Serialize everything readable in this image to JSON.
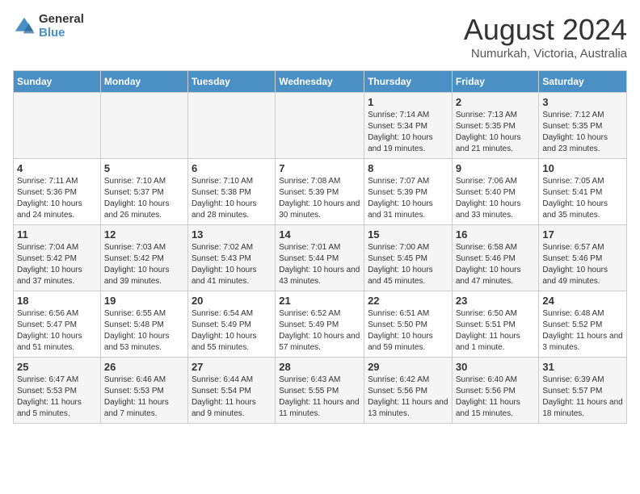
{
  "header": {
    "logo_general": "General",
    "logo_blue": "Blue",
    "month_title": "August 2024",
    "location": "Numurkah, Victoria, Australia"
  },
  "days_of_week": [
    "Sunday",
    "Monday",
    "Tuesday",
    "Wednesday",
    "Thursday",
    "Friday",
    "Saturday"
  ],
  "weeks": [
    [
      {
        "day": "",
        "info": ""
      },
      {
        "day": "",
        "info": ""
      },
      {
        "day": "",
        "info": ""
      },
      {
        "day": "",
        "info": ""
      },
      {
        "day": "1",
        "info": "Sunrise: 7:14 AM\nSunset: 5:34 PM\nDaylight: 10 hours\nand 19 minutes."
      },
      {
        "day": "2",
        "info": "Sunrise: 7:13 AM\nSunset: 5:35 PM\nDaylight: 10 hours\nand 21 minutes."
      },
      {
        "day": "3",
        "info": "Sunrise: 7:12 AM\nSunset: 5:35 PM\nDaylight: 10 hours\nand 23 minutes."
      }
    ],
    [
      {
        "day": "4",
        "info": "Sunrise: 7:11 AM\nSunset: 5:36 PM\nDaylight: 10 hours\nand 24 minutes."
      },
      {
        "day": "5",
        "info": "Sunrise: 7:10 AM\nSunset: 5:37 PM\nDaylight: 10 hours\nand 26 minutes."
      },
      {
        "day": "6",
        "info": "Sunrise: 7:10 AM\nSunset: 5:38 PM\nDaylight: 10 hours\nand 28 minutes."
      },
      {
        "day": "7",
        "info": "Sunrise: 7:08 AM\nSunset: 5:39 PM\nDaylight: 10 hours\nand 30 minutes."
      },
      {
        "day": "8",
        "info": "Sunrise: 7:07 AM\nSunset: 5:39 PM\nDaylight: 10 hours\nand 31 minutes."
      },
      {
        "day": "9",
        "info": "Sunrise: 7:06 AM\nSunset: 5:40 PM\nDaylight: 10 hours\nand 33 minutes."
      },
      {
        "day": "10",
        "info": "Sunrise: 7:05 AM\nSunset: 5:41 PM\nDaylight: 10 hours\nand 35 minutes."
      }
    ],
    [
      {
        "day": "11",
        "info": "Sunrise: 7:04 AM\nSunset: 5:42 PM\nDaylight: 10 hours\nand 37 minutes."
      },
      {
        "day": "12",
        "info": "Sunrise: 7:03 AM\nSunset: 5:42 PM\nDaylight: 10 hours\nand 39 minutes."
      },
      {
        "day": "13",
        "info": "Sunrise: 7:02 AM\nSunset: 5:43 PM\nDaylight: 10 hours\nand 41 minutes."
      },
      {
        "day": "14",
        "info": "Sunrise: 7:01 AM\nSunset: 5:44 PM\nDaylight: 10 hours\nand 43 minutes."
      },
      {
        "day": "15",
        "info": "Sunrise: 7:00 AM\nSunset: 5:45 PM\nDaylight: 10 hours\nand 45 minutes."
      },
      {
        "day": "16",
        "info": "Sunrise: 6:58 AM\nSunset: 5:46 PM\nDaylight: 10 hours\nand 47 minutes."
      },
      {
        "day": "17",
        "info": "Sunrise: 6:57 AM\nSunset: 5:46 PM\nDaylight: 10 hours\nand 49 minutes."
      }
    ],
    [
      {
        "day": "18",
        "info": "Sunrise: 6:56 AM\nSunset: 5:47 PM\nDaylight: 10 hours\nand 51 minutes."
      },
      {
        "day": "19",
        "info": "Sunrise: 6:55 AM\nSunset: 5:48 PM\nDaylight: 10 hours\nand 53 minutes."
      },
      {
        "day": "20",
        "info": "Sunrise: 6:54 AM\nSunset: 5:49 PM\nDaylight: 10 hours\nand 55 minutes."
      },
      {
        "day": "21",
        "info": "Sunrise: 6:52 AM\nSunset: 5:49 PM\nDaylight: 10 hours\nand 57 minutes."
      },
      {
        "day": "22",
        "info": "Sunrise: 6:51 AM\nSunset: 5:50 PM\nDaylight: 10 hours\nand 59 minutes."
      },
      {
        "day": "23",
        "info": "Sunrise: 6:50 AM\nSunset: 5:51 PM\nDaylight: 11 hours\nand 1 minute."
      },
      {
        "day": "24",
        "info": "Sunrise: 6:48 AM\nSunset: 5:52 PM\nDaylight: 11 hours\nand 3 minutes."
      }
    ],
    [
      {
        "day": "25",
        "info": "Sunrise: 6:47 AM\nSunset: 5:53 PM\nDaylight: 11 hours\nand 5 minutes."
      },
      {
        "day": "26",
        "info": "Sunrise: 6:46 AM\nSunset: 5:53 PM\nDaylight: 11 hours\nand 7 minutes."
      },
      {
        "day": "27",
        "info": "Sunrise: 6:44 AM\nSunset: 5:54 PM\nDaylight: 11 hours\nand 9 minutes."
      },
      {
        "day": "28",
        "info": "Sunrise: 6:43 AM\nSunset: 5:55 PM\nDaylight: 11 hours\nand 11 minutes."
      },
      {
        "day": "29",
        "info": "Sunrise: 6:42 AM\nSunset: 5:56 PM\nDaylight: 11 hours\nand 13 minutes."
      },
      {
        "day": "30",
        "info": "Sunrise: 6:40 AM\nSunset: 5:56 PM\nDaylight: 11 hours\nand 15 minutes."
      },
      {
        "day": "31",
        "info": "Sunrise: 6:39 AM\nSunset: 5:57 PM\nDaylight: 11 hours\nand 18 minutes."
      }
    ]
  ]
}
